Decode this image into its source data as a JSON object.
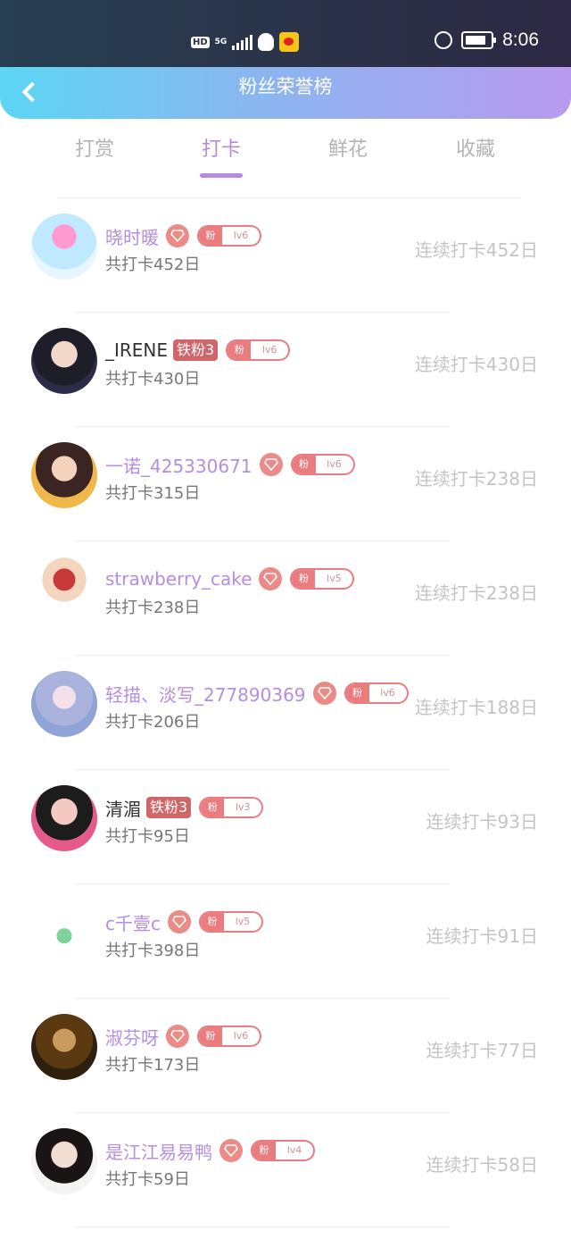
{
  "status_bar": {
    "time": "8:06",
    "hd": "HD",
    "network": "5G"
  },
  "header": {
    "title": "粉丝荣誉榜"
  },
  "tabs": [
    {
      "label": "打赏",
      "active": false
    },
    {
      "label": "打卡",
      "active": true
    },
    {
      "label": "鲜花",
      "active": false
    },
    {
      "label": "收藏",
      "active": false
    }
  ],
  "colors": {
    "accent": "#b48ce0",
    "fan_badge": "#ea7c80",
    "iron_badge": "#d0666a"
  },
  "rows": [
    {
      "name": "晓时暖",
      "name_color": "purple",
      "badge": "diamond",
      "fan_label": "粉",
      "fan_level": "lv6",
      "total": "共打卡452日",
      "streak": "连续打卡452日"
    },
    {
      "name": "_IRENE",
      "name_color": "dark",
      "badge": "铁粉3",
      "fan_label": "粉",
      "fan_level": "lv6",
      "total": "共打卡430日",
      "streak": "连续打卡430日"
    },
    {
      "name": "一诺_425330671",
      "name_color": "purple",
      "badge": "diamond",
      "fan_label": "粉",
      "fan_level": "lv6",
      "total": "共打卡315日",
      "streak": "连续打卡238日"
    },
    {
      "name": "strawberry_cake",
      "name_color": "purple",
      "badge": "diamond",
      "fan_label": "粉",
      "fan_level": "lv5",
      "total": "共打卡238日",
      "streak": "连续打卡238日"
    },
    {
      "name": "轻描、淡写_277890369",
      "name_color": "purple",
      "badge": "diamond",
      "fan_label": "粉",
      "fan_level": "lv6",
      "total": "共打卡206日",
      "streak": "连续打卡188日"
    },
    {
      "name": "清湄",
      "name_color": "dark",
      "badge": "铁粉3",
      "fan_label": "粉",
      "fan_level": "lv3",
      "total": "共打卡95日",
      "streak": "连续打卡93日"
    },
    {
      "name": "c千壹c",
      "name_color": "purple",
      "badge": "diamond",
      "fan_label": "粉",
      "fan_level": "lv5",
      "total": "共打卡398日",
      "streak": "连续打卡91日"
    },
    {
      "name": "淑芬呀",
      "name_color": "purple",
      "badge": "diamond",
      "fan_label": "粉",
      "fan_level": "lv6",
      "total": "共打卡173日",
      "streak": "连续打卡77日"
    },
    {
      "name": "是江江易易鸭",
      "name_color": "purple",
      "badge": "diamond",
      "fan_label": "粉",
      "fan_level": "lv4",
      "total": "共打卡59日",
      "streak": "连续打卡58日"
    }
  ]
}
